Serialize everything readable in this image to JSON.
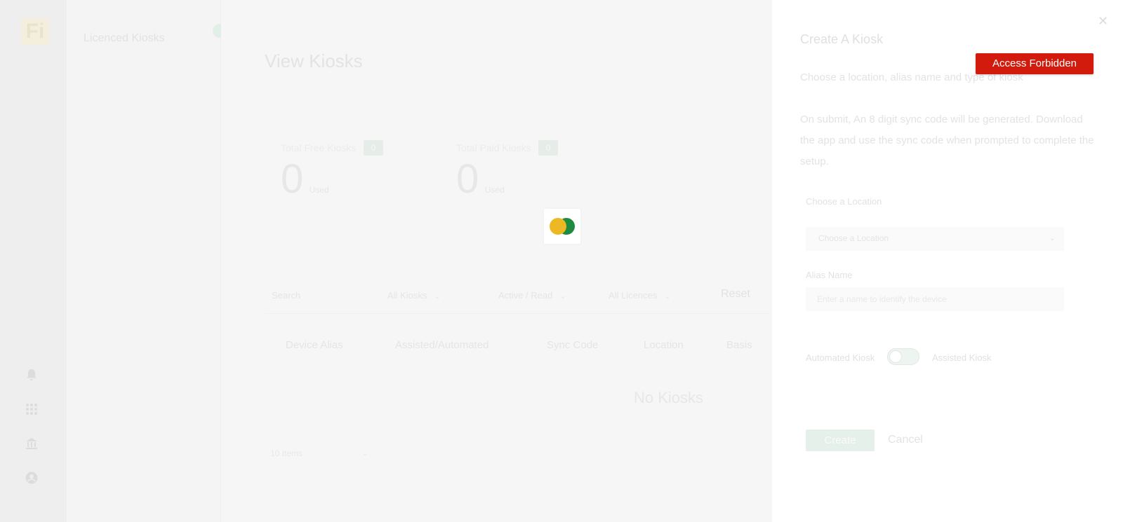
{
  "rail": {
    "logo_text": "Fi",
    "icons": [
      "bell-icon",
      "apps-grid-icon",
      "bank-icon",
      "account-icon"
    ]
  },
  "subnav": {
    "title": "Licenced Kiosks"
  },
  "main": {
    "page_title": "View Kiosks",
    "stats": [
      {
        "label": "Total Free Kiosks",
        "badge": "0",
        "value": "0",
        "unit": "Used"
      },
      {
        "label": "Total Paid Kiosks",
        "badge": "0",
        "value": "0",
        "unit": "Used"
      }
    ],
    "filters": {
      "search_placeholder": "Search",
      "kiosk_type": "All Kiosks",
      "status": "Active / Read",
      "licences": "All Licences",
      "reset_label": "Reset"
    },
    "table_headers": [
      "Device Alias",
      "Assisted/Automated",
      "Sync Code",
      "Location",
      "Basis"
    ],
    "empty_text": "No Kiosks",
    "page_size": "10 Items"
  },
  "drawer": {
    "close_symbol": "✕",
    "title": "Create A Kiosk",
    "intro": "Choose a location, alias name and type of kiosk",
    "instructions": "On submit, An 8 digit sync code will be generated. Download the app and use the sync code when prompted to complete the setup.",
    "location_label": "Choose a Location",
    "location_selected": "Choose a Location",
    "alias_label": "Alias Name",
    "alias_placeholder": "Enter a name to identify the device",
    "toggle_left": "Automated Kiosk",
    "toggle_right": "Assisted Kiosk",
    "create_label": "Create",
    "cancel_label": "Cancel"
  },
  "alert": {
    "text": "Access Forbidden",
    "color": "#d21b0d"
  },
  "loader": {
    "colors": [
      "#ecb924",
      "#1f8b41"
    ]
  }
}
